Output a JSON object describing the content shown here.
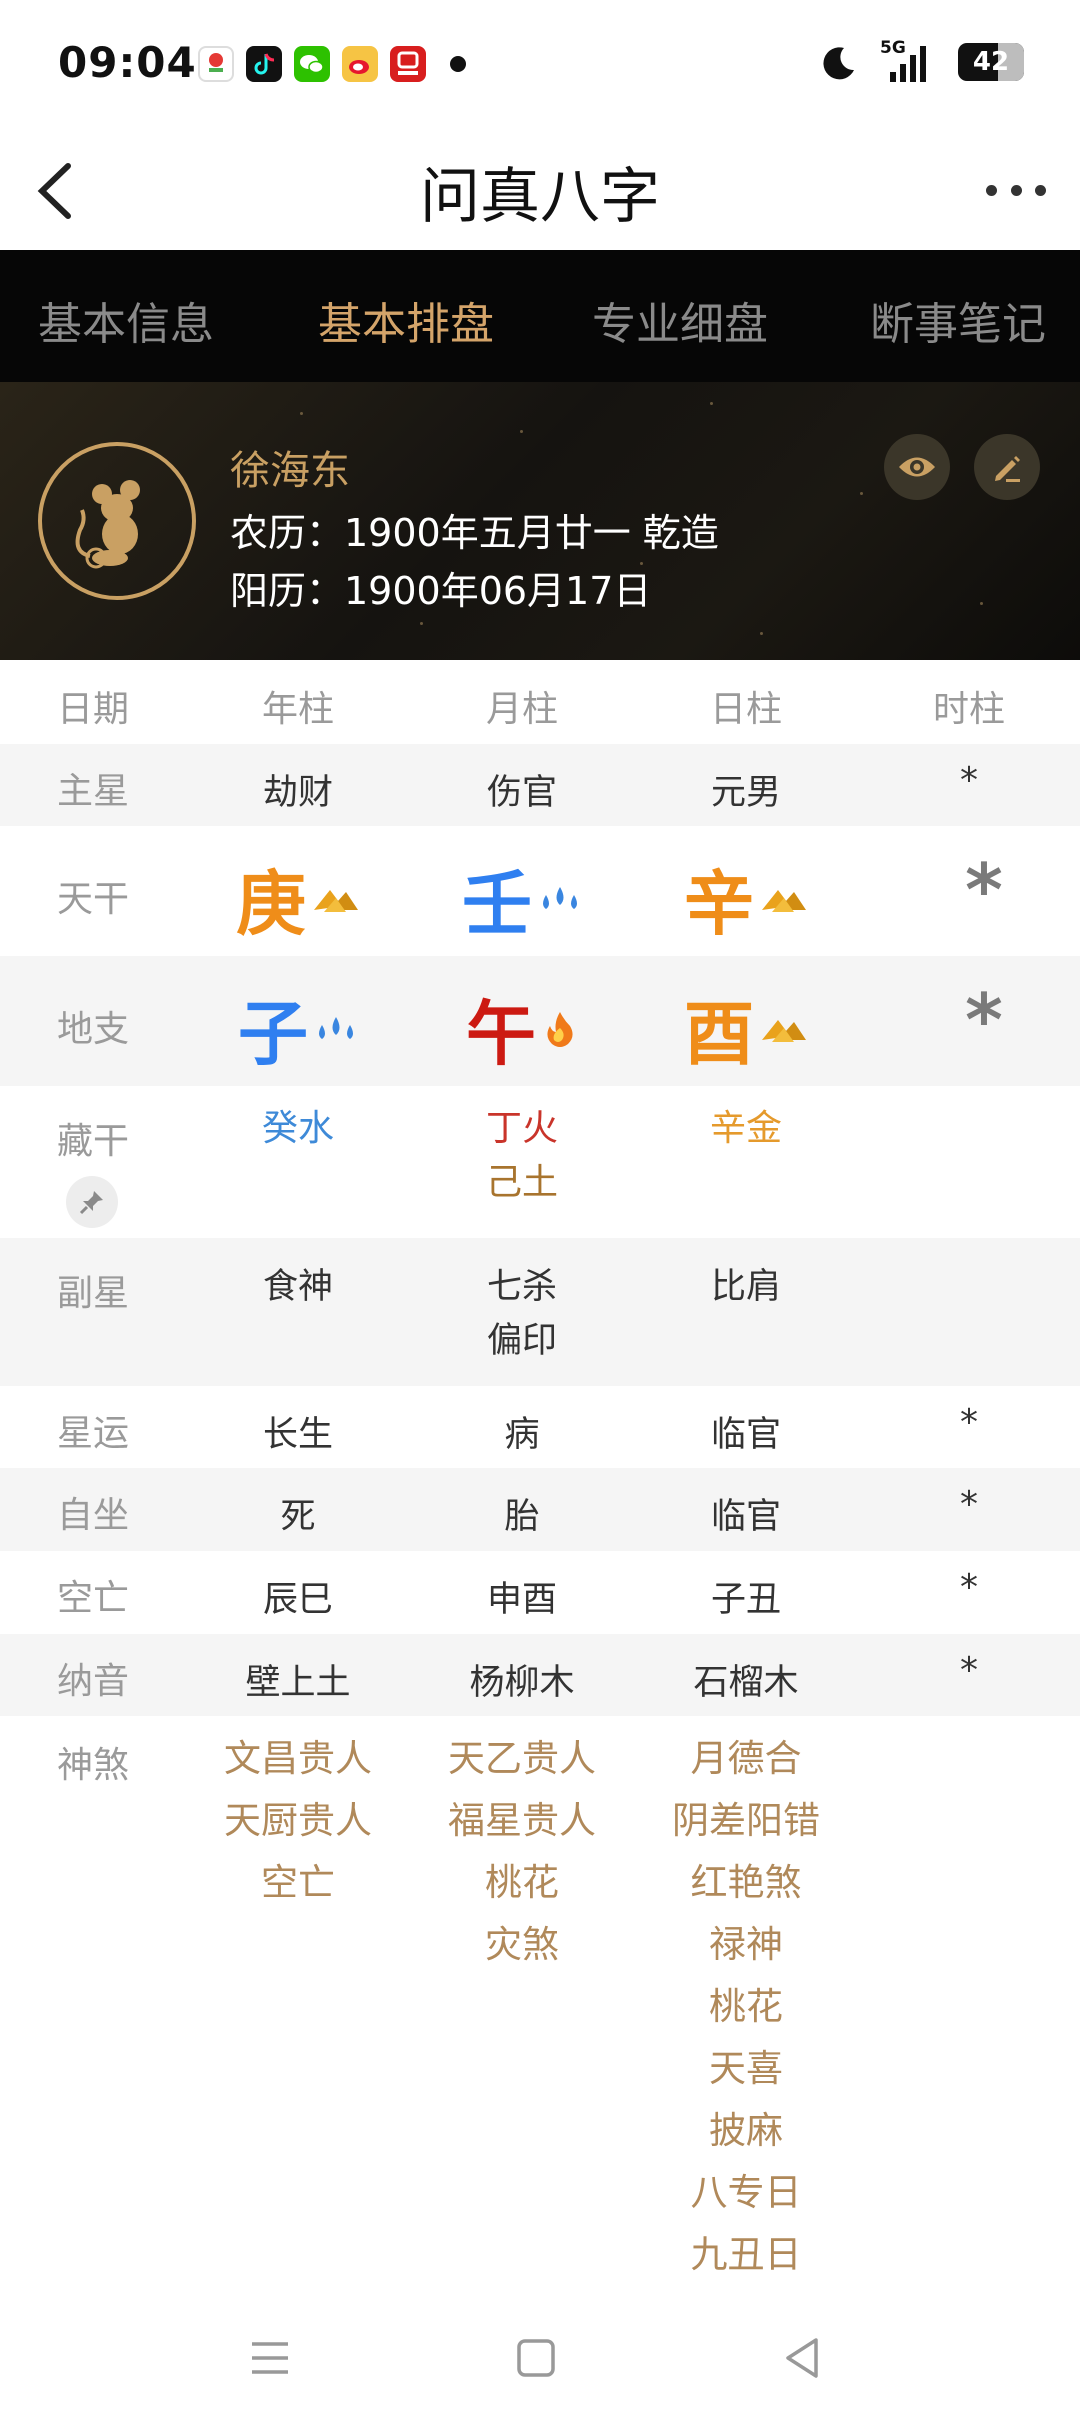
{
  "status_bar": {
    "time": "09:04",
    "network": "5G",
    "battery": "42"
  },
  "app_bar": {
    "title": "问真八字"
  },
  "tabs": [
    {
      "label": "基本信息",
      "active": false
    },
    {
      "label": "基本排盘",
      "active": true
    },
    {
      "label": "专业细盘",
      "active": false
    },
    {
      "label": "断事笔记",
      "active": false
    }
  ],
  "profile": {
    "name": "徐海东",
    "lunar": "农历：1900年五月廿一 乾造",
    "solar": "阳历：1900年06月17日"
  },
  "table": {
    "headers": [
      "日期",
      "年柱",
      "月柱",
      "日柱",
      "时柱"
    ],
    "main_star": {
      "label": "主星",
      "values": [
        "劫财",
        "伤官",
        "元男",
        "*"
      ]
    },
    "tiangan": {
      "label": "天干",
      "values": [
        "庚",
        "壬",
        "辛",
        "*"
      ],
      "elements": [
        "metal-icon",
        "water-icon",
        "metal-icon"
      ]
    },
    "dizhi": {
      "label": "地支",
      "values": [
        "子",
        "午",
        "酉",
        "*"
      ],
      "elements": [
        "water-icon",
        "fire-icon",
        "metal-icon"
      ]
    },
    "canggan": {
      "label": "藏干",
      "values": [
        [
          "癸水"
        ],
        [
          "丁火",
          "己土"
        ],
        [
          "辛金"
        ],
        []
      ]
    },
    "fuxing": {
      "label": "副星",
      "values": [
        [
          "食神"
        ],
        [
          "七杀",
          "偏印"
        ],
        [
          "比肩"
        ],
        []
      ]
    },
    "xingyun": {
      "label": "星运",
      "values": [
        "长生",
        "病",
        "临官",
        "*"
      ]
    },
    "zizuo": {
      "label": "自坐",
      "values": [
        "死",
        "胎",
        "临官",
        "*"
      ]
    },
    "kongwang": {
      "label": "空亡",
      "values": [
        "辰巳",
        "申酉",
        "子丑",
        "*"
      ]
    },
    "nayin": {
      "label": "纳音",
      "values": [
        "壁上土",
        "杨柳木",
        "石榴木",
        "*"
      ]
    },
    "shensha": {
      "label": "神煞",
      "year": [
        "文昌贵人",
        "天厨贵人",
        "空亡"
      ],
      "month": [
        "天乙贵人",
        "福星贵人",
        "桃花",
        "灾煞"
      ],
      "day": [
        "月德合",
        "阴差阳错",
        "红艳煞",
        "禄神",
        "桃花",
        "天喜",
        "披麻",
        "八专日",
        "九丑日"
      ]
    }
  },
  "colors": {
    "accent_gold": "#c9a063",
    "metal": "#ef8d19",
    "water": "#2f7ff0",
    "fire": "#cc1a12",
    "shensha": "#b0895a"
  }
}
